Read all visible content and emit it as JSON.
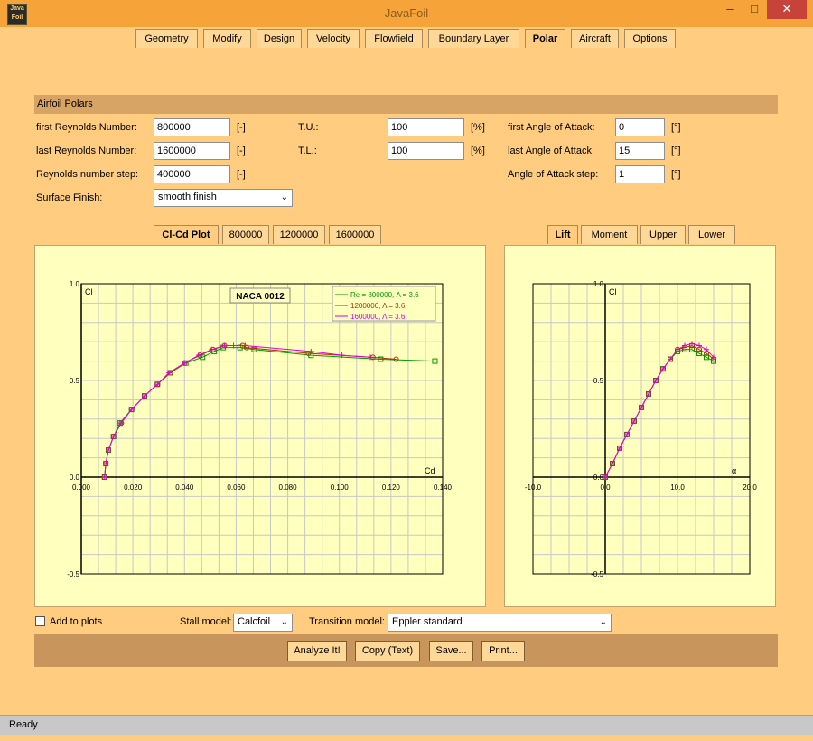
{
  "window": {
    "title": "JavaFoil",
    "icon_text": "Java Foil",
    "minimize_glyph": "–",
    "maximize_glyph": "□",
    "close_glyph": "✕"
  },
  "tabs": [
    "Geometry",
    "Modify",
    "Design",
    "Velocity",
    "Flowfield",
    "Boundary Layer",
    "Polar",
    "Aircraft",
    "Options"
  ],
  "active_tab": "Polar",
  "section_title": "Airfoil Polars",
  "params": {
    "first_re_label": "first Reynolds Number:",
    "first_re_value": "800000",
    "first_re_unit": "[-]",
    "last_re_label": "last Reynolds Number:",
    "last_re_value": "1600000",
    "last_re_unit": "[-]",
    "re_step_label": "Reynolds number step:",
    "re_step_value": "400000",
    "re_step_unit": "[-]",
    "surface_label": "Surface Finish:",
    "surface_value": "smooth finish",
    "tu_label": "T.U.:",
    "tu_value": "100",
    "tu_unit": "[%]",
    "tl_label": "T.L.:",
    "tl_value": "100",
    "tl_unit": "[%]",
    "first_aoa_label": "first Angle of Attack:",
    "first_aoa_value": "0",
    "first_aoa_unit": "[°]",
    "last_aoa_label": "last Angle of Attack:",
    "last_aoa_value": "15",
    "last_aoa_unit": "[°]",
    "aoa_step_label": "Angle of Attack step:",
    "aoa_step_value": "1",
    "aoa_step_unit": "[°]"
  },
  "plot_tabs_left": [
    "Cl-Cd Plot",
    "800000",
    "1200000",
    "1600000"
  ],
  "plot_tabs_right": [
    "Lift",
    "Moment",
    "Upper",
    "Lower"
  ],
  "bottom": {
    "add_to_plots": "Add to plots",
    "stall_label": "Stall model:",
    "stall_value": "Calcfoil",
    "transition_label": "Transition model:",
    "transition_value": "Eppler standard",
    "buttons": [
      "Analyze It!",
      "Copy (Text)",
      "Save...",
      "Print..."
    ]
  },
  "status": "Ready",
  "colors": {
    "series": [
      "#009900",
      "#b03000",
      "#e000e0"
    ]
  },
  "chart_data": [
    {
      "type": "line",
      "title": "NACA 0012",
      "xlabel": "Cd",
      "ylabel": "Cl",
      "xlim": [
        0.0,
        0.14
      ],
      "ylim": [
        -0.5,
        1.0
      ],
      "xticks": [
        "0.000",
        "0.020",
        "0.040",
        "0.060",
        "0.080",
        "0.100",
        "0.120",
        "0.140"
      ],
      "yticks": [
        "1.0",
        "0.5",
        "0.0",
        "-0.5"
      ],
      "legend_position": "top-right",
      "series": [
        {
          "name": "Re = 800000, Λ = 3.6",
          "x": [
            0.009,
            0.0095,
            0.0105,
            0.0125,
            0.015,
            0.0195,
            0.0245,
            0.0295,
            0.0345,
            0.0405,
            0.047,
            0.0515,
            0.055,
            0.0615,
            0.067,
            0.089,
            0.116,
            0.137
          ],
          "y": [
            0.0,
            0.07,
            0.14,
            0.21,
            0.28,
            0.35,
            0.42,
            0.48,
            0.54,
            0.59,
            0.62,
            0.65,
            0.67,
            0.67,
            0.66,
            0.63,
            0.61,
            0.6
          ]
        },
        {
          "name": "1200000, Λ = 3.6",
          "x": [
            0.009,
            0.0095,
            0.0105,
            0.0125,
            0.0155,
            0.0195,
            0.0245,
            0.0295,
            0.0345,
            0.04,
            0.046,
            0.051,
            0.0555,
            0.0625,
            0.064,
            0.088,
            0.113,
            0.122
          ],
          "y": [
            0.0,
            0.07,
            0.14,
            0.21,
            0.28,
            0.35,
            0.42,
            0.48,
            0.54,
            0.59,
            0.63,
            0.66,
            0.68,
            0.68,
            0.67,
            0.64,
            0.62,
            0.61
          ]
        },
        {
          "name": "1600000, Λ = 3.6",
          "x": [
            0.009,
            0.0095,
            0.0105,
            0.0125,
            0.0155,
            0.0195,
            0.0245,
            0.0295,
            0.034,
            0.04,
            0.0455,
            0.0505,
            0.0555,
            0.059,
            0.0635,
            0.089,
            0.101,
            0.112
          ],
          "y": [
            0.0,
            0.07,
            0.14,
            0.21,
            0.28,
            0.35,
            0.42,
            0.48,
            0.54,
            0.59,
            0.63,
            0.66,
            0.68,
            0.68,
            0.68,
            0.65,
            0.63,
            0.62
          ]
        }
      ]
    },
    {
      "type": "line",
      "xlabel": "α",
      "ylabel": "Cl",
      "xlim": [
        -10.0,
        20.0
      ],
      "ylim": [
        -0.5,
        1.0
      ],
      "xticks": [
        "-10.0",
        "0.0",
        "10.0",
        "20.0"
      ],
      "yticks": [
        "1.0",
        "0.5",
        "0.0",
        "-0.5"
      ],
      "series": [
        {
          "x": [
            0,
            1,
            2,
            3,
            4,
            5,
            6,
            7,
            8,
            9,
            10,
            11,
            12,
            13,
            14,
            15
          ],
          "y": [
            0.0,
            0.07,
            0.15,
            0.22,
            0.29,
            0.36,
            0.43,
            0.5,
            0.56,
            0.61,
            0.65,
            0.66,
            0.66,
            0.64,
            0.62,
            0.6
          ]
        },
        {
          "x": [
            0,
            1,
            2,
            3,
            4,
            5,
            6,
            7,
            8,
            9,
            10,
            11,
            12,
            13,
            14,
            15
          ],
          "y": [
            0.0,
            0.07,
            0.15,
            0.22,
            0.29,
            0.36,
            0.43,
            0.5,
            0.56,
            0.61,
            0.66,
            0.67,
            0.68,
            0.66,
            0.64,
            0.61
          ]
        },
        {
          "x": [
            0,
            1,
            2,
            3,
            4,
            5,
            6,
            7,
            8,
            9,
            10,
            11,
            12,
            13,
            14,
            15
          ],
          "y": [
            0.0,
            0.07,
            0.15,
            0.22,
            0.29,
            0.36,
            0.43,
            0.5,
            0.56,
            0.61,
            0.66,
            0.68,
            0.69,
            0.68,
            0.66,
            0.62
          ]
        }
      ]
    }
  ]
}
